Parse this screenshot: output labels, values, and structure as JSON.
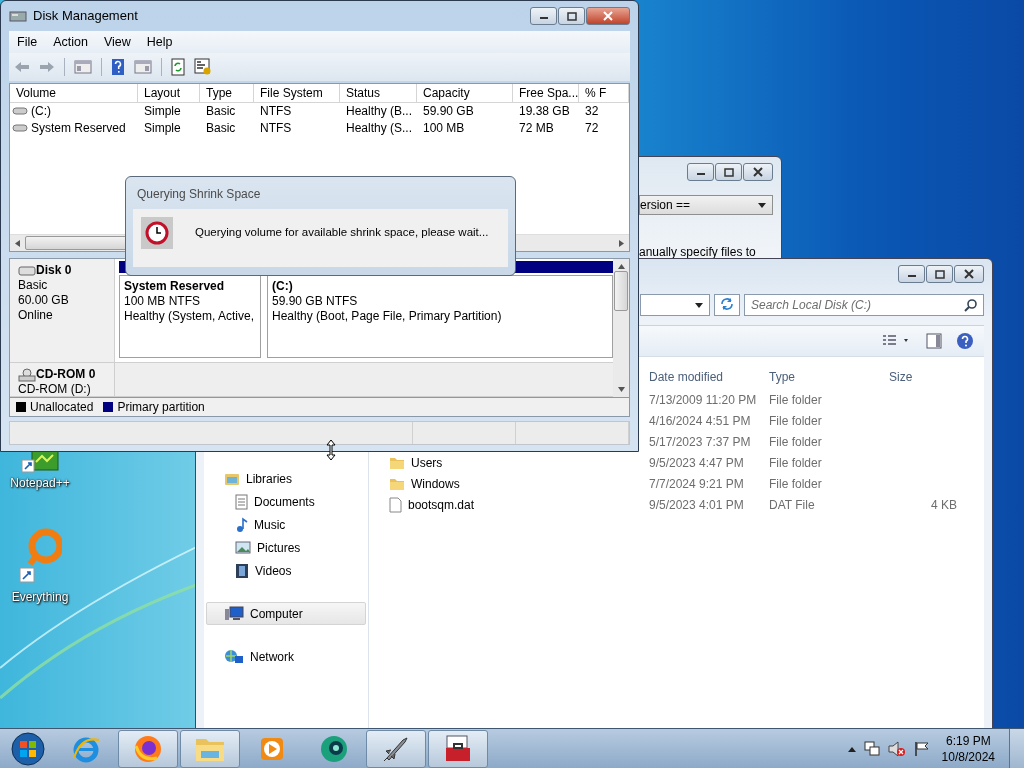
{
  "desktop_icons": [
    {
      "kind": "notepad",
      "label": "Notepad++"
    },
    {
      "kind": "everything",
      "label": "Everything"
    }
  ],
  "background_window": {
    "dropdown_value": "ersion ==",
    "text": "anually specify files to"
  },
  "explorer": {
    "search": {
      "placeholder": "Search Local Disk (C:)"
    },
    "nav": [
      {
        "kind": "libraries",
        "label": "Libraries",
        "selected": false,
        "children": [
          {
            "kind": "documents",
            "label": "Documents",
            "selected": false
          },
          {
            "kind": "music",
            "label": "Music",
            "selected": false
          },
          {
            "kind": "pictures",
            "label": "Pictures",
            "selected": false
          },
          {
            "kind": "videos",
            "label": "Videos",
            "selected": false
          }
        ]
      },
      {
        "kind": "computer",
        "label": "Computer",
        "selected": true
      },
      {
        "kind": "network",
        "label": "Network",
        "selected": false
      }
    ],
    "columns": [
      "Date modified",
      "Type",
      "Size"
    ],
    "files": [
      {
        "kind": "hidden",
        "date": "7/13/2009 11:20 PM",
        "type": "File folder"
      },
      {
        "kind": "hidden",
        "date": "4/16/2024 4:51 PM",
        "type": "File folder"
      },
      {
        "kind": "hidden",
        "date": "5/17/2023 7:37 PM",
        "type": "File folder"
      },
      {
        "kind": "folder",
        "name": "Users",
        "date": "9/5/2023 4:47 PM",
        "type": "File folder"
      },
      {
        "kind": "folder",
        "name": "Windows",
        "date": "7/7/2024 9:21 PM",
        "type": "File folder"
      },
      {
        "kind": "file",
        "name": "bootsqm.dat",
        "date": "9/5/2023 4:01 PM",
        "type": "DAT File",
        "size": "4 KB"
      }
    ]
  },
  "disk_management": {
    "title": "Disk Management",
    "menu": [
      "File",
      "Action",
      "View",
      "Help"
    ],
    "columns": [
      "Volume",
      "Layout",
      "Type",
      "File System",
      "Status",
      "Capacity",
      "Free Spa...",
      "% F"
    ],
    "volumes": [
      {
        "cells": [
          "(C:)",
          "Simple",
          "Basic",
          "NTFS",
          "Healthy (B...",
          "59.90 GB",
          "19.38 GB",
          "32"
        ]
      },
      {
        "cells": [
          "System Reserved",
          "Simple",
          "Basic",
          "NTFS",
          "Healthy (S...",
          "100 MB",
          "72 MB",
          "72"
        ]
      }
    ],
    "disks": [
      {
        "kind": "disk",
        "name": "Disk 0",
        "lines": [
          "Basic",
          "60.00 GB",
          "Online"
        ],
        "partitions": [
          {
            "name": "System Reserved",
            "size": "100 MB NTFS",
            "status": "Healthy (System, Active,"
          },
          {
            "name": "(C:)",
            "size": "59.90 GB NTFS",
            "status": "Healthy (Boot, Page File, Primary Partition)"
          }
        ]
      },
      {
        "kind": "cdrom",
        "name": "CD-ROM 0",
        "lines": [
          "CD-ROM (D:)"
        ]
      }
    ],
    "legend": [
      {
        "label": "Unallocated",
        "color": "#000000"
      },
      {
        "label": "Primary partition",
        "color": "#000080"
      }
    ]
  },
  "dialog": {
    "title": "Querying Shrink Space",
    "message": "Querying volume for available shrink space, please wait..."
  },
  "taskbar": {
    "apps": [
      {
        "kind": "ie",
        "running": false
      },
      {
        "kind": "firefox",
        "running": true
      },
      {
        "kind": "explorer",
        "running": true
      },
      {
        "kind": "media",
        "running": false
      },
      {
        "kind": "disc",
        "running": false
      },
      {
        "kind": "rocket",
        "running": true
      },
      {
        "kind": "toolbox",
        "running": true
      }
    ],
    "clock": {
      "time": "6:19 PM",
      "date": "10/8/2024"
    }
  }
}
